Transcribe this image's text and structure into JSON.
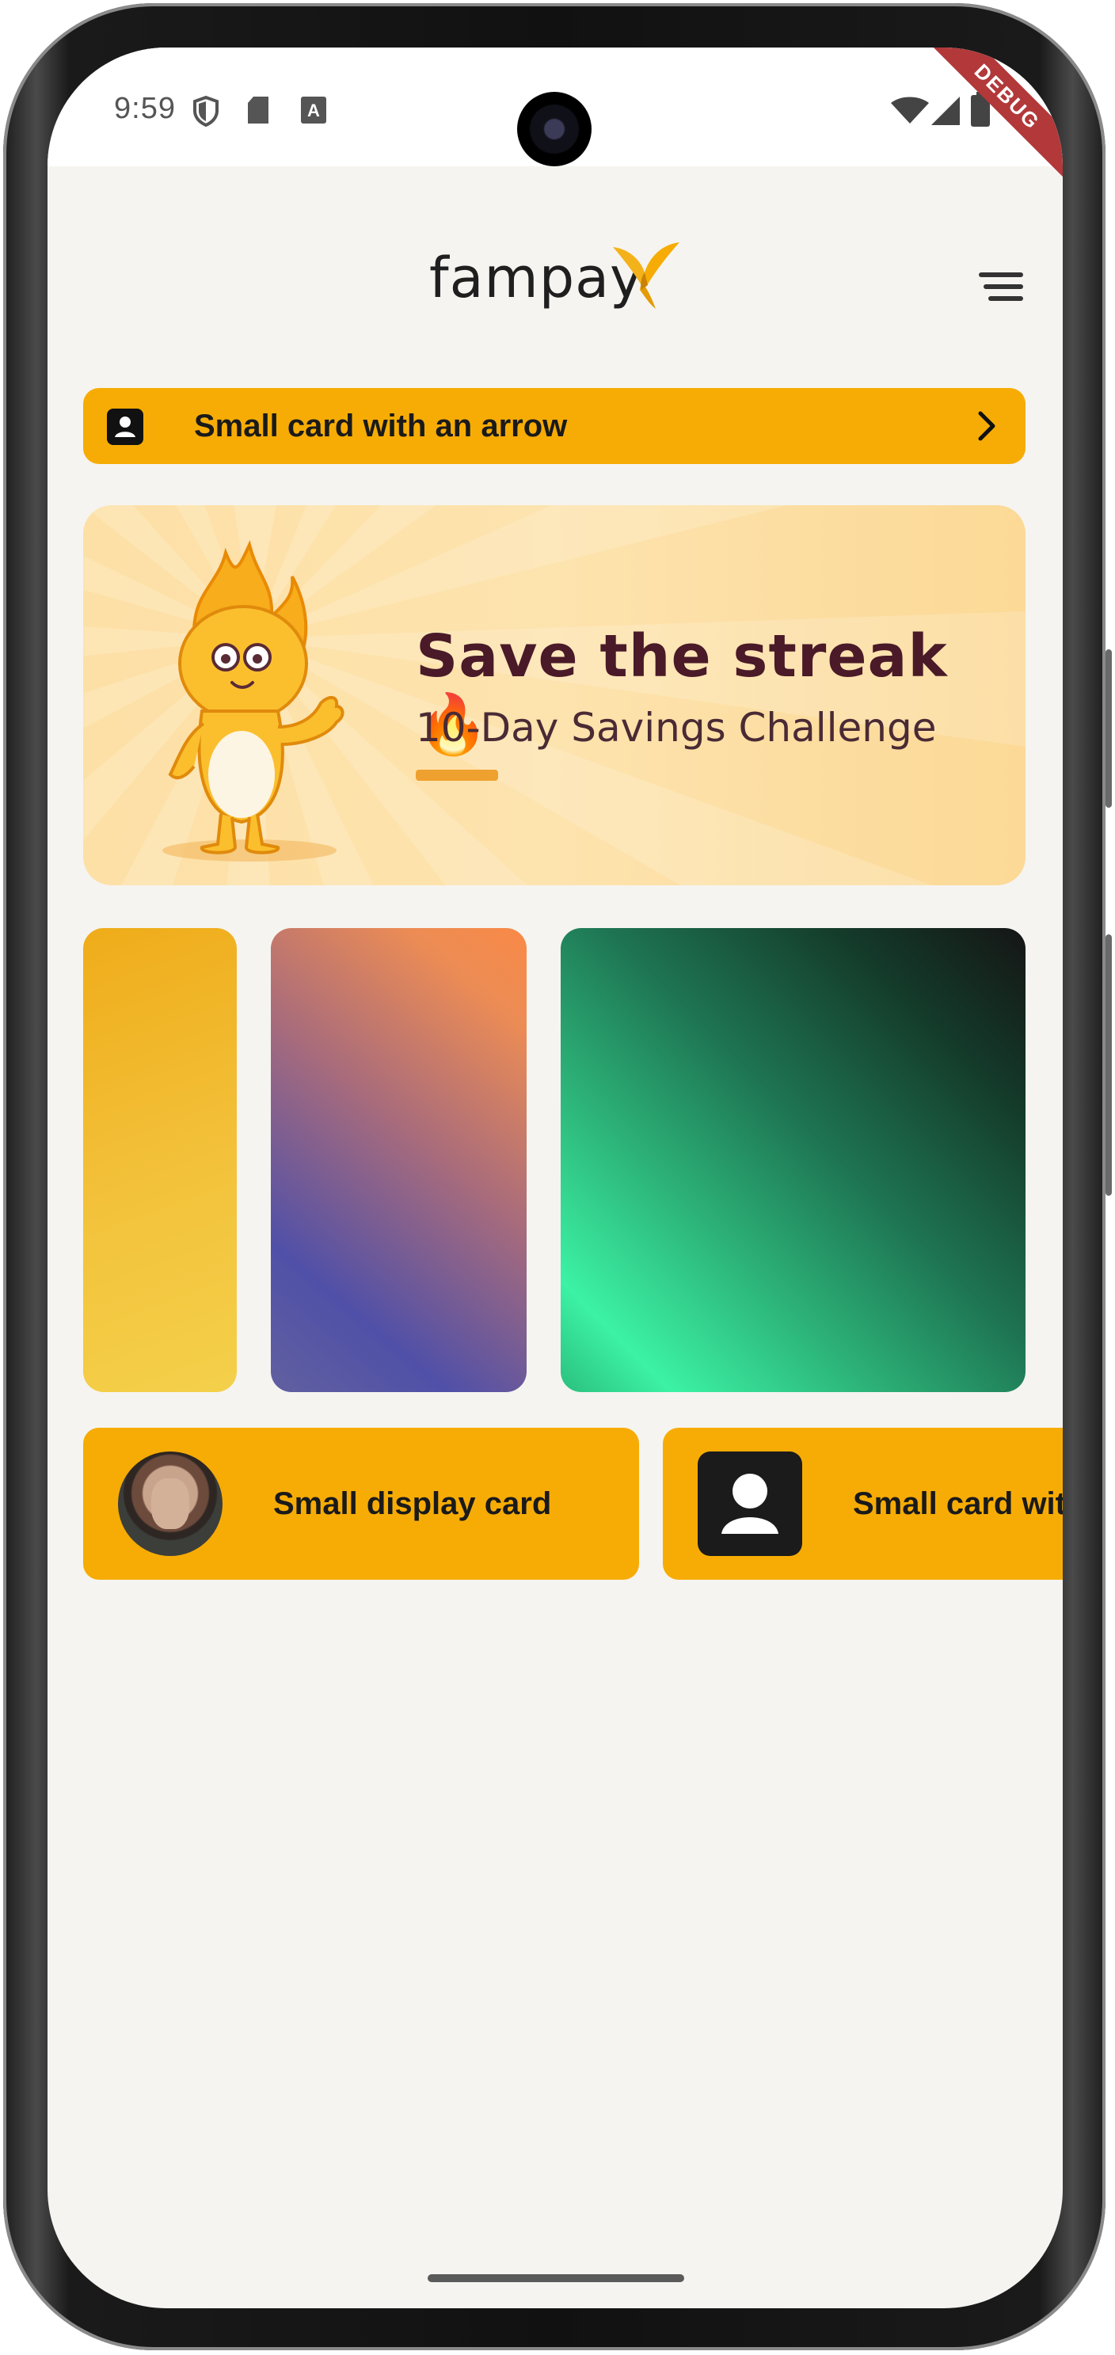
{
  "status_bar": {
    "time": "9:59",
    "debug_banner": "DEBUG",
    "icons": [
      "shield-icon",
      "sd-card-icon",
      "keyboard-a-icon",
      "wifi-icon",
      "signal-icon",
      "battery-icon"
    ]
  },
  "app_bar": {
    "brand": "fampay",
    "logo": "fampay-bird-logo-icon",
    "menu_icon": "menu-icon"
  },
  "arrow_card": {
    "label": "Small card with an arrow",
    "icon": "user-icon",
    "arrow_icon": "chevron-right-icon"
  },
  "banner": {
    "title": "Save the streak 🔥",
    "subtitle": "10-Day Savings Challenge",
    "illustration": "fire-mascot-icon"
  },
  "gradient_cards": [
    {
      "name": "yellow-gradient-card"
    },
    {
      "name": "orange-blue-gradient-card"
    },
    {
      "name": "green-black-gradient-card"
    }
  ],
  "display_cards": [
    {
      "label": "Small display card",
      "image": "avatar-photo"
    },
    {
      "label": "Small card with an arrow",
      "icon": "user-icon"
    }
  ],
  "colors": {
    "accent": "#f7ac05",
    "background": "#f5f4f0",
    "banner_title": "#4a1a28"
  }
}
